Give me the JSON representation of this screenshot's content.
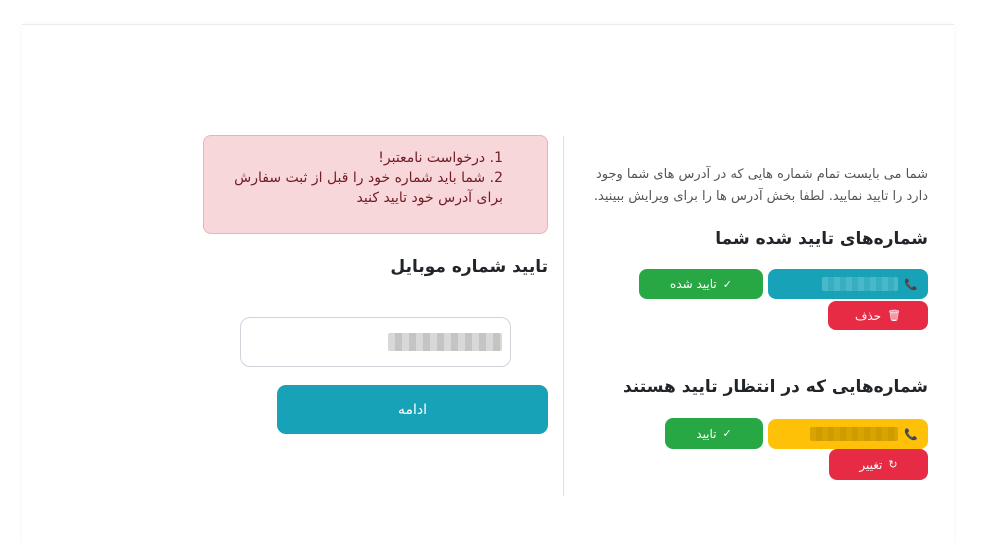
{
  "info_text": "شما می بایست تمام شماره هایی که در آدرس های شما وجود دارد را تایید نمایید. لطفا بخش آدرس ها را برای ویرایش ببینید.",
  "verified": {
    "title": "شماره‌های تایید شده شما",
    "status_label": "تایید شده",
    "delete_label": "حذف"
  },
  "pending": {
    "title": "شماره‌هایی که در انتظار تایید هستند",
    "verify_label": "تایید",
    "change_label": "تغییر"
  },
  "alert": {
    "items": [
      "1. درخواست نامعتبر!",
      "2. شما باید شماره خود را قبل از ثبت سفارش برای آدرس خود تایید کنید"
    ]
  },
  "mobile_form": {
    "title": "تایید شماره موبایل",
    "continue_label": "ادامه"
  },
  "colors": {
    "info": "#17a2b8",
    "success": "#28a745",
    "danger": "#e82b45",
    "warning": "#ffc107"
  }
}
